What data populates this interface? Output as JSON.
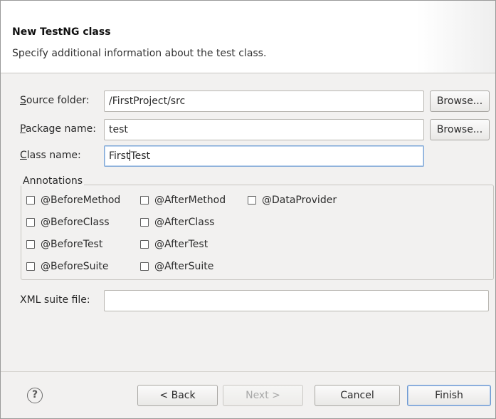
{
  "banner": {
    "title": "New TestNG class",
    "description": "Specify additional information about the test class."
  },
  "form": {
    "source_folder": {
      "label_mnemonic": "S",
      "label_rest": "ource folder:",
      "value": "/FirstProject/src",
      "browse": "Browse..."
    },
    "package_name": {
      "label_mnemonic": "P",
      "label_rest": "ackage name:",
      "value": "test",
      "browse": "Browse..."
    },
    "class_name": {
      "label_mnemonic": "C",
      "label_rest": "lass name:",
      "value_before_caret": "First",
      "value_after_caret": "Test"
    },
    "xml_suite": {
      "label": "XML suite file:",
      "value": ""
    }
  },
  "annotations": {
    "title": "Annotations",
    "items": [
      {
        "label": "@BeforeMethod",
        "checked": false
      },
      {
        "label": "@AfterMethod",
        "checked": false
      },
      {
        "label": "@DataProvider",
        "checked": false
      },
      {
        "label": "@BeforeClass",
        "checked": false
      },
      {
        "label": "@AfterClass",
        "checked": false
      },
      {
        "label": "@BeforeTest",
        "checked": false
      },
      {
        "label": "@AfterTest",
        "checked": false
      },
      {
        "label": "@BeforeSuite",
        "checked": false
      },
      {
        "label": "@AfterSuite",
        "checked": false
      }
    ]
  },
  "footer": {
    "help": "?",
    "back": "< Back",
    "next": "Next >",
    "cancel": "Cancel",
    "finish": "Finish"
  },
  "colors": {
    "focus_border": "#7ea6d6",
    "disabled_text": "#a8a8a8"
  }
}
